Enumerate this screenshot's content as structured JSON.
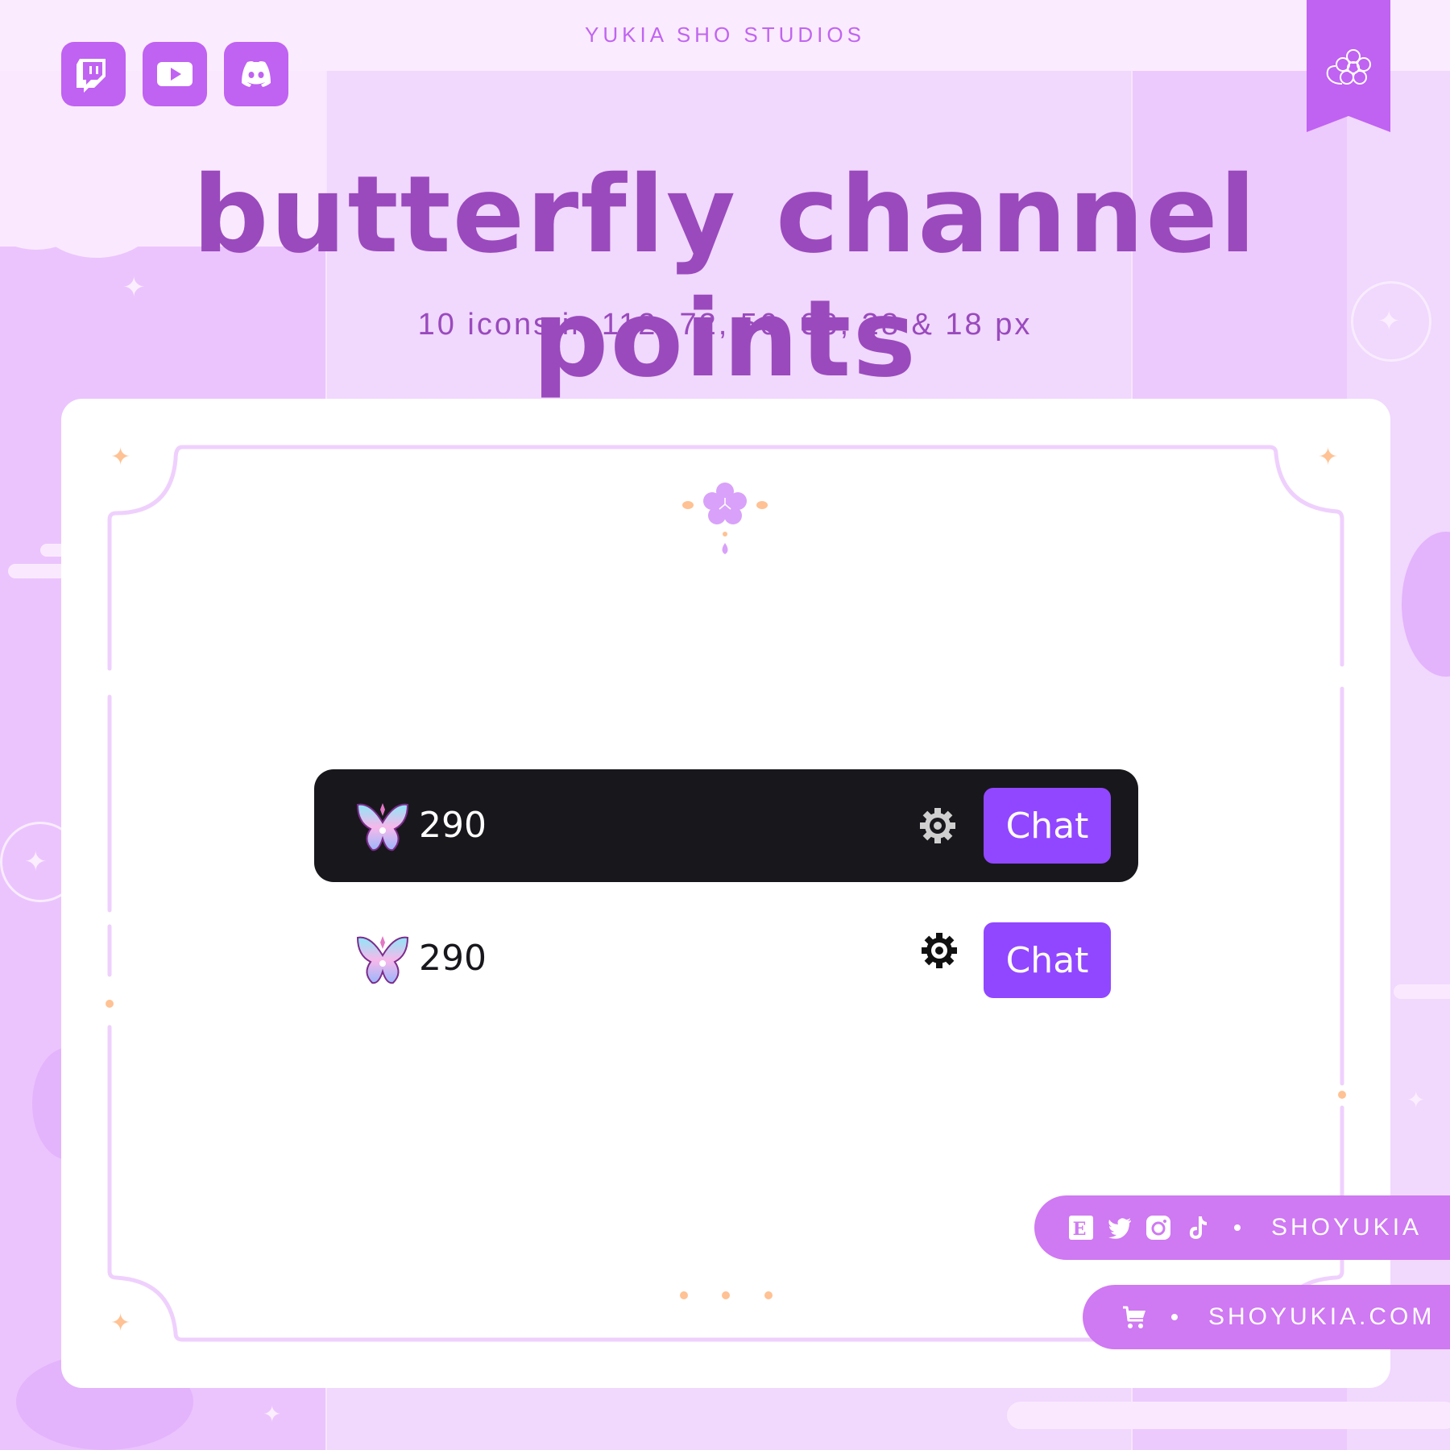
{
  "header": {
    "brand": "YUKIA SHO STUDIOS",
    "social_icons": [
      "twitch-icon",
      "youtube-icon",
      "discord-icon"
    ],
    "ribbon_icon": "sakura-flower-icon"
  },
  "hero": {
    "title": "butterfly channel points",
    "subtitle": "10 icons in 112, 72, 56, 36, 28 & 18 px"
  },
  "preview": {
    "dark_theme": {
      "points_icon": "butterfly-icon",
      "points_value": "290",
      "settings_icon": "gear-icon",
      "chat_button": "Chat"
    },
    "light_theme": {
      "points_icon": "butterfly-icon",
      "points_value": "290",
      "settings_icon": "gear-icon",
      "chat_button": "Chat"
    }
  },
  "footer": {
    "social_handle_icons": [
      "etsy-icon",
      "twitter-icon",
      "instagram-icon",
      "tiktok-icon"
    ],
    "social_handle": "SHOYUKIA",
    "shop_icon": "cart-icon",
    "website": "SHOYUKIA.COM"
  },
  "colors": {
    "brand_purple": "#c062f2",
    "title_purple": "#9a4abd",
    "twitch_purple": "#9147ff",
    "dark_bar": "#18171c",
    "accent_peach": "#ffc294",
    "pill_purple": "#cf79f2"
  }
}
